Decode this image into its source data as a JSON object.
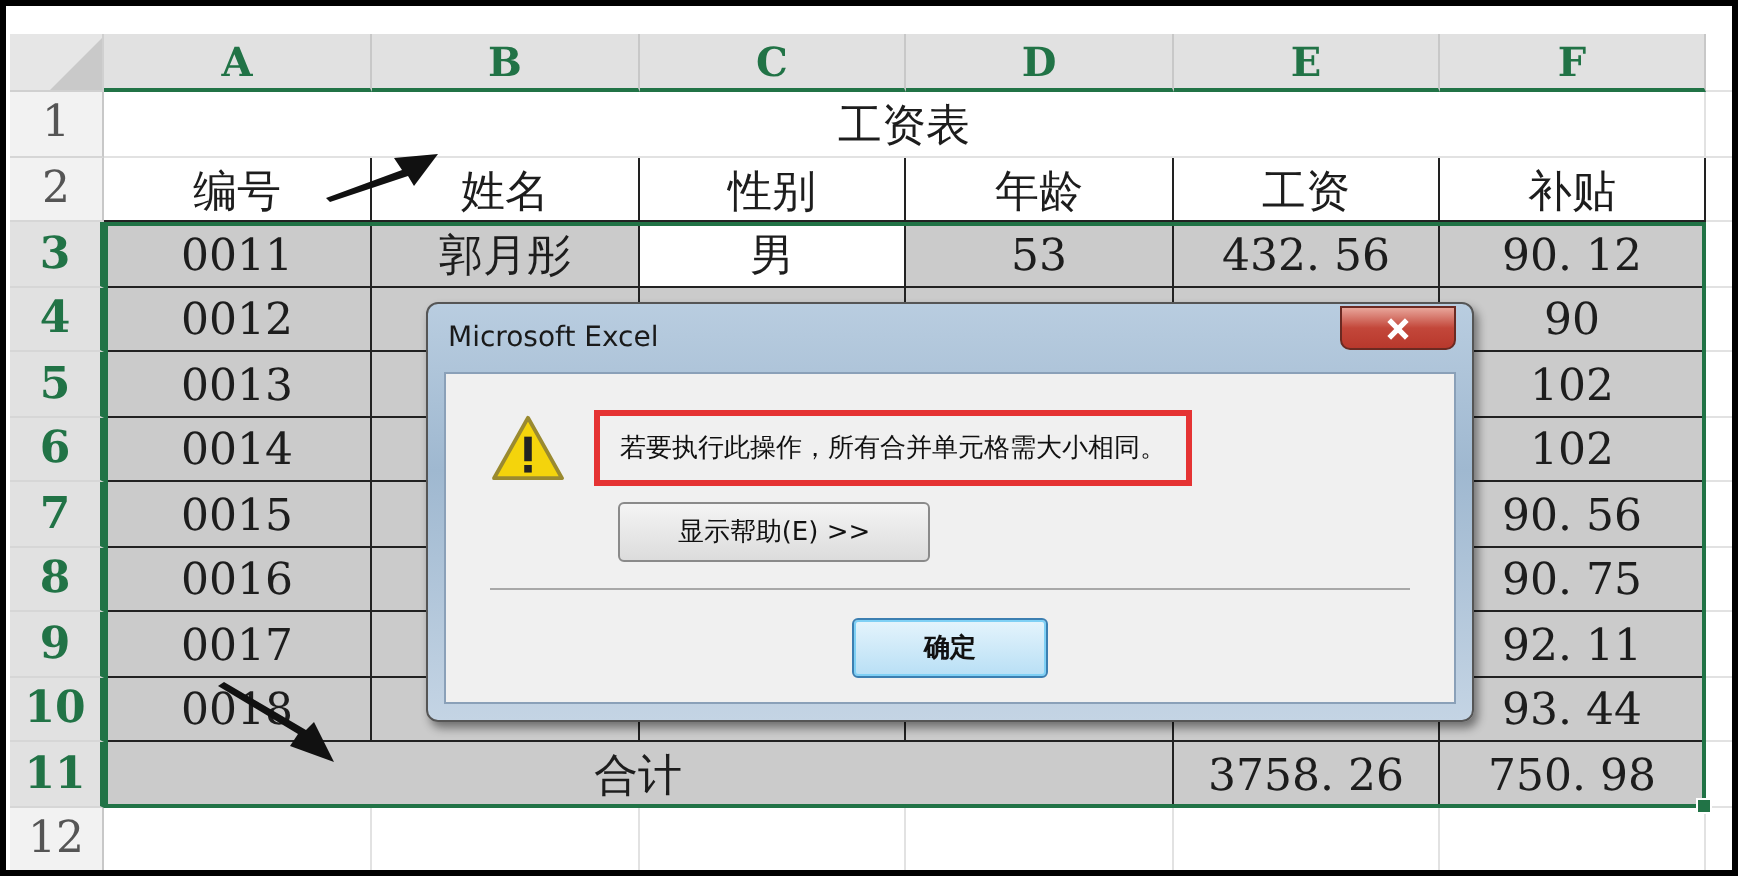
{
  "sheet": {
    "columns": [
      {
        "label": "A",
        "selected": true
      },
      {
        "label": "B",
        "selected": true
      },
      {
        "label": "C",
        "selected": true
      },
      {
        "label": "D",
        "selected": true
      },
      {
        "label": "E",
        "selected": true
      },
      {
        "label": "F",
        "selected": true
      }
    ],
    "rows": [
      {
        "number": "1",
        "selected": false,
        "cells": [
          {
            "text": "工资表",
            "shaded": false
          }
        ]
      },
      {
        "number": "2",
        "selected": false,
        "cells": [
          {
            "text": "编号",
            "shaded": false
          },
          {
            "text": "姓名",
            "shaded": false
          },
          {
            "text": "性别",
            "shaded": false
          },
          {
            "text": "年龄",
            "shaded": false
          },
          {
            "text": "工资",
            "shaded": false
          },
          {
            "text": "补贴",
            "shaded": false
          }
        ]
      },
      {
        "number": "3",
        "selected": true,
        "cells": [
          {
            "text": "0011",
            "shaded": true
          },
          {
            "text": "郭月彤",
            "shaded": true
          },
          {
            "text": "男",
            "shaded": false
          },
          {
            "text": "53",
            "shaded": true
          },
          {
            "text": "432. 56",
            "shaded": true
          },
          {
            "text": "90. 12",
            "shaded": true
          }
        ]
      },
      {
        "number": "4",
        "selected": true,
        "cells": [
          {
            "text": "0012",
            "shaded": true
          },
          null,
          null,
          null,
          null,
          {
            "text": "90",
            "shaded": true
          }
        ]
      },
      {
        "number": "5",
        "selected": true,
        "cells": [
          {
            "text": "0013",
            "shaded": true
          },
          null,
          null,
          null,
          null,
          {
            "text": "102",
            "shaded": true
          }
        ]
      },
      {
        "number": "6",
        "selected": true,
        "cells": [
          {
            "text": "0014",
            "shaded": true
          },
          null,
          null,
          null,
          null,
          {
            "text": "102",
            "shaded": true
          }
        ]
      },
      {
        "number": "7",
        "selected": true,
        "cells": [
          {
            "text": "0015",
            "shaded": true
          },
          null,
          null,
          null,
          null,
          {
            "text": "90. 56",
            "shaded": true
          }
        ]
      },
      {
        "number": "8",
        "selected": true,
        "cells": [
          {
            "text": "0016",
            "shaded": true
          },
          null,
          null,
          null,
          null,
          {
            "text": "90. 75",
            "shaded": true
          }
        ]
      },
      {
        "number": "9",
        "selected": true,
        "cells": [
          {
            "text": "0017",
            "shaded": true
          },
          null,
          null,
          null,
          null,
          {
            "text": "92. 11",
            "shaded": true
          }
        ]
      },
      {
        "number": "10",
        "selected": true,
        "cells": [
          {
            "text": "0018",
            "shaded": true
          },
          null,
          null,
          null,
          null,
          {
            "text": "93. 44",
            "shaded": true
          }
        ]
      },
      {
        "number": "11",
        "selected": true,
        "cells": [
          {
            "text": "合计",
            "shaded": true
          },
          {
            "text": "3758. 26",
            "shaded": true
          },
          {
            "text": "750. 98",
            "shaded": true
          }
        ]
      },
      {
        "number": "12",
        "selected": false
      }
    ]
  },
  "dialog": {
    "title": "Microsoft Excel",
    "message": "若要执行此操作，所有合并单元格需大小相同。",
    "help_button": "显示帮助(E) >>",
    "ok_button": "确定"
  }
}
